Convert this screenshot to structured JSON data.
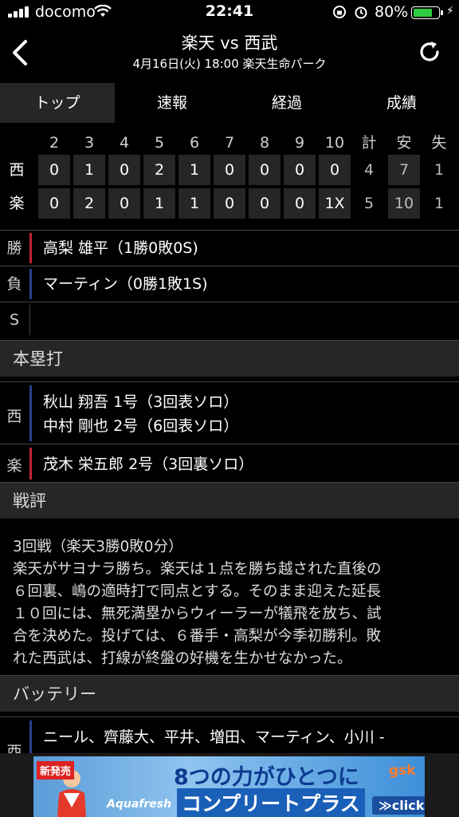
{
  "status": {
    "carrier": "docomo",
    "time": "22:41",
    "battery": "80%",
    "battery_level": 0.8
  },
  "header": {
    "title": "楽天 vs 西武",
    "subtitle": "4月16日(火) 18:00 楽天生命パーク"
  },
  "tabs": [
    {
      "label": "トップ",
      "active": true
    },
    {
      "label": "速報"
    },
    {
      "label": "経過"
    },
    {
      "label": "成績"
    }
  ],
  "scoreboard": {
    "header": [
      "2",
      "3",
      "4",
      "5",
      "6",
      "7",
      "8",
      "9",
      "10",
      "計",
      "安",
      "失"
    ],
    "rows": [
      {
        "team": "西",
        "cells": [
          "0",
          "1",
          "0",
          "2",
          "1",
          "0",
          "0",
          "0",
          "0",
          "4",
          "7",
          "1"
        ]
      },
      {
        "team": "楽",
        "cells": [
          "0",
          "2",
          "0",
          "1",
          "1",
          "0",
          "0",
          "0",
          "1X",
          "5",
          "10",
          "1"
        ]
      }
    ]
  },
  "pitchers": {
    "win_label": "勝",
    "win": "高梨 雄平（1勝0敗0S)",
    "loss_label": "負",
    "loss": "マーティン（0勝1敗1S)",
    "save_label": "S",
    "save": ""
  },
  "homeruns": {
    "title": "本塁打",
    "groups": [
      {
        "team": "西",
        "lines": [
          "秋山 翔吾 1号（3回表ソロ）",
          "中村 剛也 2号（6回表ソロ）"
        ]
      },
      {
        "team": "楽",
        "lines": [
          "茂木 栄五郎 2号（3回裏ソロ）"
        ]
      }
    ]
  },
  "review": {
    "title": "戦評",
    "lines": [
      "3回戦（楽天3勝0敗0分）",
      "楽天がサヨナラ勝ち。楽天は１点を勝ち越された直後の",
      "６回裏、嶋の適時打で同点とする。そのまま迎えた延長",
      "１０回には、無死満塁からウィーラーが犠飛を放ち、試",
      "合を決めた。投げては、６番手・高梨が今季初勝利。敗",
      "れた西武は、打線が終盤の好機を生かせなかった。"
    ]
  },
  "battery_section": {
    "title": "バッテリー",
    "team": "西",
    "line": "ニール、齊藤大、平井、増田、マーティン、小川 -"
  },
  "ad": {
    "badge": "新発売",
    "headline": "8つの力がひとつに",
    "subline": "コンプリートプラス",
    "brand": "Aquafresh",
    "logo": "gsk",
    "click": "≫click",
    "info": "i"
  }
}
